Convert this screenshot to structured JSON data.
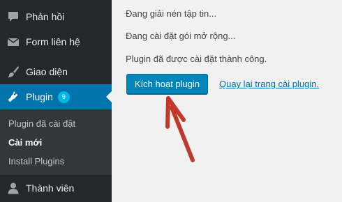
{
  "sidebar": {
    "items": [
      {
        "label": "Phản hồi",
        "icon": "comment-icon"
      },
      {
        "label": "Form liên hệ",
        "icon": "envelope-icon"
      },
      {
        "label": "Giao diện",
        "icon": "paintbrush-icon"
      },
      {
        "label": "Plugin",
        "icon": "plug-icon",
        "badge": "9",
        "active": true
      },
      {
        "label": "Thành viên",
        "icon": "user-icon"
      }
    ],
    "submenu": [
      {
        "label": "Plugin đã cài đặt"
      },
      {
        "label": "Cài mới",
        "current": true
      },
      {
        "label": "Install Plugins"
      }
    ]
  },
  "main": {
    "messages": [
      "Đang giải nén tập tin...",
      "Đang cài đặt gói mở rộng...",
      "Plugin đã được cài đặt thành công."
    ],
    "activate_button": "Kích hoạt plugin",
    "back_link": "Quay lại trang cài plugin."
  },
  "colors": {
    "sidebar_bg": "#23282d",
    "submenu_bg": "#32373c",
    "accent": "#0073aa",
    "button": "#0085ba",
    "badge": "#00b9eb",
    "annotation_arrow": "#c0392b",
    "page_bg": "#f1f1f1"
  }
}
